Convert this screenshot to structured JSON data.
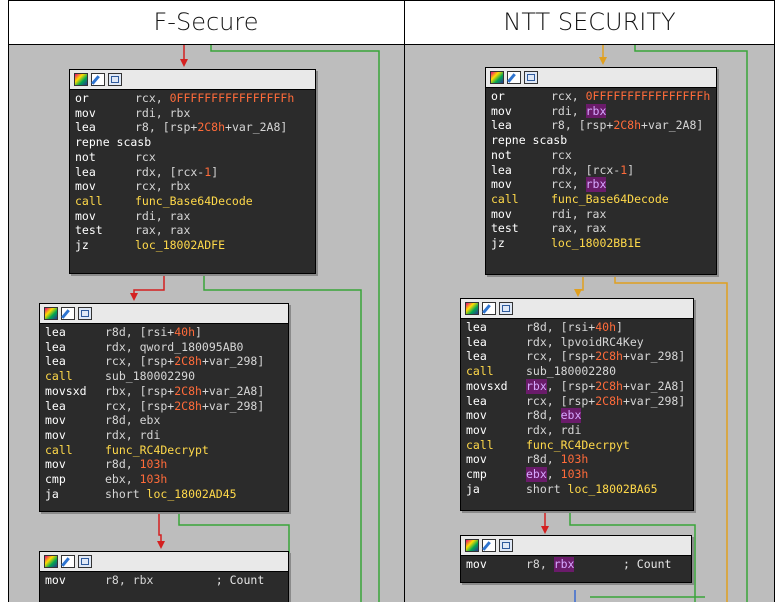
{
  "headers": {
    "left": "F-Secure",
    "right": "NTT SECURITY"
  },
  "left": {
    "block1": [
      {
        "m": "or",
        "ops": [
          [
            "rcx, ",
            ""
          ],
          [
            "0FFFFFFFFFFFFFFFFh",
            "num"
          ]
        ]
      },
      {
        "m": "mov",
        "ops": [
          [
            "rdi, rbx",
            ""
          ]
        ]
      },
      {
        "m": "lea",
        "ops": [
          [
            "r8, [rsp+",
            ""
          ],
          [
            "2C8h",
            "num"
          ],
          [
            "+var_2A8]",
            ""
          ]
        ]
      },
      {
        "m": "repne scasb",
        "ops": []
      },
      {
        "m": "not",
        "ops": [
          [
            "rcx",
            ""
          ]
        ]
      },
      {
        "m": "lea",
        "ops": [
          [
            "rdx, [rcx-",
            ""
          ],
          [
            "1",
            "num"
          ],
          [
            "]",
            ""
          ]
        ]
      },
      {
        "m": "mov",
        "ops": [
          [
            "rcx, rbx",
            ""
          ]
        ]
      },
      {
        "m": "call",
        "ops": [
          [
            "func_Base64Decode",
            "hi"
          ]
        ],
        "hi": true
      },
      {
        "m": "mov",
        "ops": [
          [
            "rdi, rax",
            ""
          ]
        ]
      },
      {
        "m": "test",
        "ops": [
          [
            "rax, rax",
            ""
          ]
        ]
      },
      {
        "m": "jz",
        "ops": [
          [
            "loc_18002ADFE",
            "hi"
          ]
        ]
      }
    ],
    "block2": [
      {
        "m": "lea",
        "ops": [
          [
            "r8d, [rsi+",
            ""
          ],
          [
            "40h",
            "num"
          ],
          [
            "]",
            ""
          ]
        ]
      },
      {
        "m": "lea",
        "ops": [
          [
            "rdx, qword_180095AB0",
            ""
          ]
        ]
      },
      {
        "m": "lea",
        "ops": [
          [
            "rcx, [rsp+",
            ""
          ],
          [
            "2C8h",
            "num"
          ],
          [
            "+var_298]",
            ""
          ]
        ]
      },
      {
        "m": "call",
        "ops": [
          [
            "sub_180002290",
            ""
          ]
        ],
        "hi": true
      },
      {
        "m": "movsxd",
        "ops": [
          [
            "rbx, [rsp+",
            ""
          ],
          [
            "2C8h",
            "num"
          ],
          [
            "+var_2A8]",
            ""
          ]
        ]
      },
      {
        "m": "lea",
        "ops": [
          [
            "rcx, [rsp+",
            ""
          ],
          [
            "2C8h",
            "num"
          ],
          [
            "+var_298]",
            ""
          ]
        ]
      },
      {
        "m": "mov",
        "ops": [
          [
            "r8d, ebx",
            ""
          ]
        ]
      },
      {
        "m": "mov",
        "ops": [
          [
            "rdx, rdi",
            ""
          ]
        ]
      },
      {
        "m": "call",
        "ops": [
          [
            "func_RC4Decrypt",
            "hi"
          ]
        ],
        "hi": true
      },
      {
        "m": "mov",
        "ops": [
          [
            "r8d, ",
            ""
          ],
          [
            "103h",
            "num"
          ]
        ]
      },
      {
        "m": "cmp",
        "ops": [
          [
            "ebx, ",
            ""
          ],
          [
            "103h",
            "num"
          ]
        ]
      },
      {
        "m": "ja",
        "ops": [
          [
            "short ",
            ""
          ],
          [
            "loc_18002AD45",
            "hi"
          ]
        ]
      }
    ],
    "block3": [
      {
        "m": "mov",
        "ops": [
          [
            "r8, rbx",
            ""
          ],
          [
            "         ; Count",
            "cmt"
          ]
        ]
      }
    ]
  },
  "right": {
    "block1": [
      {
        "m": "or",
        "ops": [
          [
            "rcx, ",
            ""
          ],
          [
            "0FFFFFFFFFFFFFFFFh",
            "num"
          ]
        ]
      },
      {
        "m": "mov",
        "ops": [
          [
            "rdi, ",
            ""
          ],
          [
            "rbx",
            "mg"
          ]
        ]
      },
      {
        "m": "lea",
        "ops": [
          [
            "r8, [rsp+",
            ""
          ],
          [
            "2C8h",
            "num"
          ],
          [
            "+var_2A8]",
            ""
          ]
        ]
      },
      {
        "m": "repne scasb",
        "ops": []
      },
      {
        "m": "not",
        "ops": [
          [
            "rcx",
            ""
          ]
        ]
      },
      {
        "m": "lea",
        "ops": [
          [
            "rdx, [rcx-",
            ""
          ],
          [
            "1",
            "num"
          ],
          [
            "]",
            ""
          ]
        ]
      },
      {
        "m": "mov",
        "ops": [
          [
            "rcx, ",
            ""
          ],
          [
            "rbx",
            "mg"
          ]
        ]
      },
      {
        "m": "call",
        "ops": [
          [
            "func_Base64Decode",
            "hi"
          ]
        ],
        "hi": true
      },
      {
        "m": "mov",
        "ops": [
          [
            "rdi, rax",
            ""
          ]
        ]
      },
      {
        "m": "test",
        "ops": [
          [
            "rax, rax",
            ""
          ]
        ]
      },
      {
        "m": "jz",
        "ops": [
          [
            "loc_18002BB1E",
            "hi"
          ]
        ]
      }
    ],
    "block2": [
      {
        "m": "lea",
        "ops": [
          [
            "r8d, [rsi+",
            ""
          ],
          [
            "40h",
            "num"
          ],
          [
            "]",
            ""
          ]
        ]
      },
      {
        "m": "lea",
        "ops": [
          [
            "rdx, lpvoidRC4Key",
            ""
          ]
        ]
      },
      {
        "m": "lea",
        "ops": [
          [
            "rcx, [rsp+",
            ""
          ],
          [
            "2C8h",
            "num"
          ],
          [
            "+var_298]",
            ""
          ]
        ]
      },
      {
        "m": "call",
        "ops": [
          [
            "sub_180002280",
            ""
          ]
        ],
        "hi": true
      },
      {
        "m": "movsxd",
        "ops": [
          [
            "rbx",
            "mg"
          ],
          [
            ", [rsp+",
            ""
          ],
          [
            "2C8h",
            "num"
          ],
          [
            "+var_2A8]",
            ""
          ]
        ]
      },
      {
        "m": "lea",
        "ops": [
          [
            "rcx, [rsp+",
            ""
          ],
          [
            "2C8h",
            "num"
          ],
          [
            "+var_298]",
            ""
          ]
        ]
      },
      {
        "m": "mov",
        "ops": [
          [
            "r8d, ",
            ""
          ],
          [
            "ebx",
            "mg"
          ]
        ]
      },
      {
        "m": "mov",
        "ops": [
          [
            "rdx, rdi",
            ""
          ]
        ]
      },
      {
        "m": "call",
        "ops": [
          [
            "func_RC4Decrpyt",
            "hi"
          ]
        ],
        "hi": true
      },
      {
        "m": "mov",
        "ops": [
          [
            "r8d, ",
            ""
          ],
          [
            "103h",
            "num"
          ]
        ]
      },
      {
        "m": "cmp",
        "ops": [
          [
            "ebx",
            "mg"
          ],
          [
            ", ",
            ""
          ],
          [
            "103h",
            "num"
          ]
        ]
      },
      {
        "m": "ja",
        "ops": [
          [
            "short ",
            ""
          ],
          [
            "loc_18002BA65",
            "hi"
          ]
        ]
      }
    ],
    "block3": [
      {
        "m": "mov",
        "ops": [
          [
            "r8, ",
            ""
          ],
          [
            "rbx",
            "mg"
          ],
          [
            "       ; Count",
            "cmt"
          ]
        ]
      }
    ]
  }
}
